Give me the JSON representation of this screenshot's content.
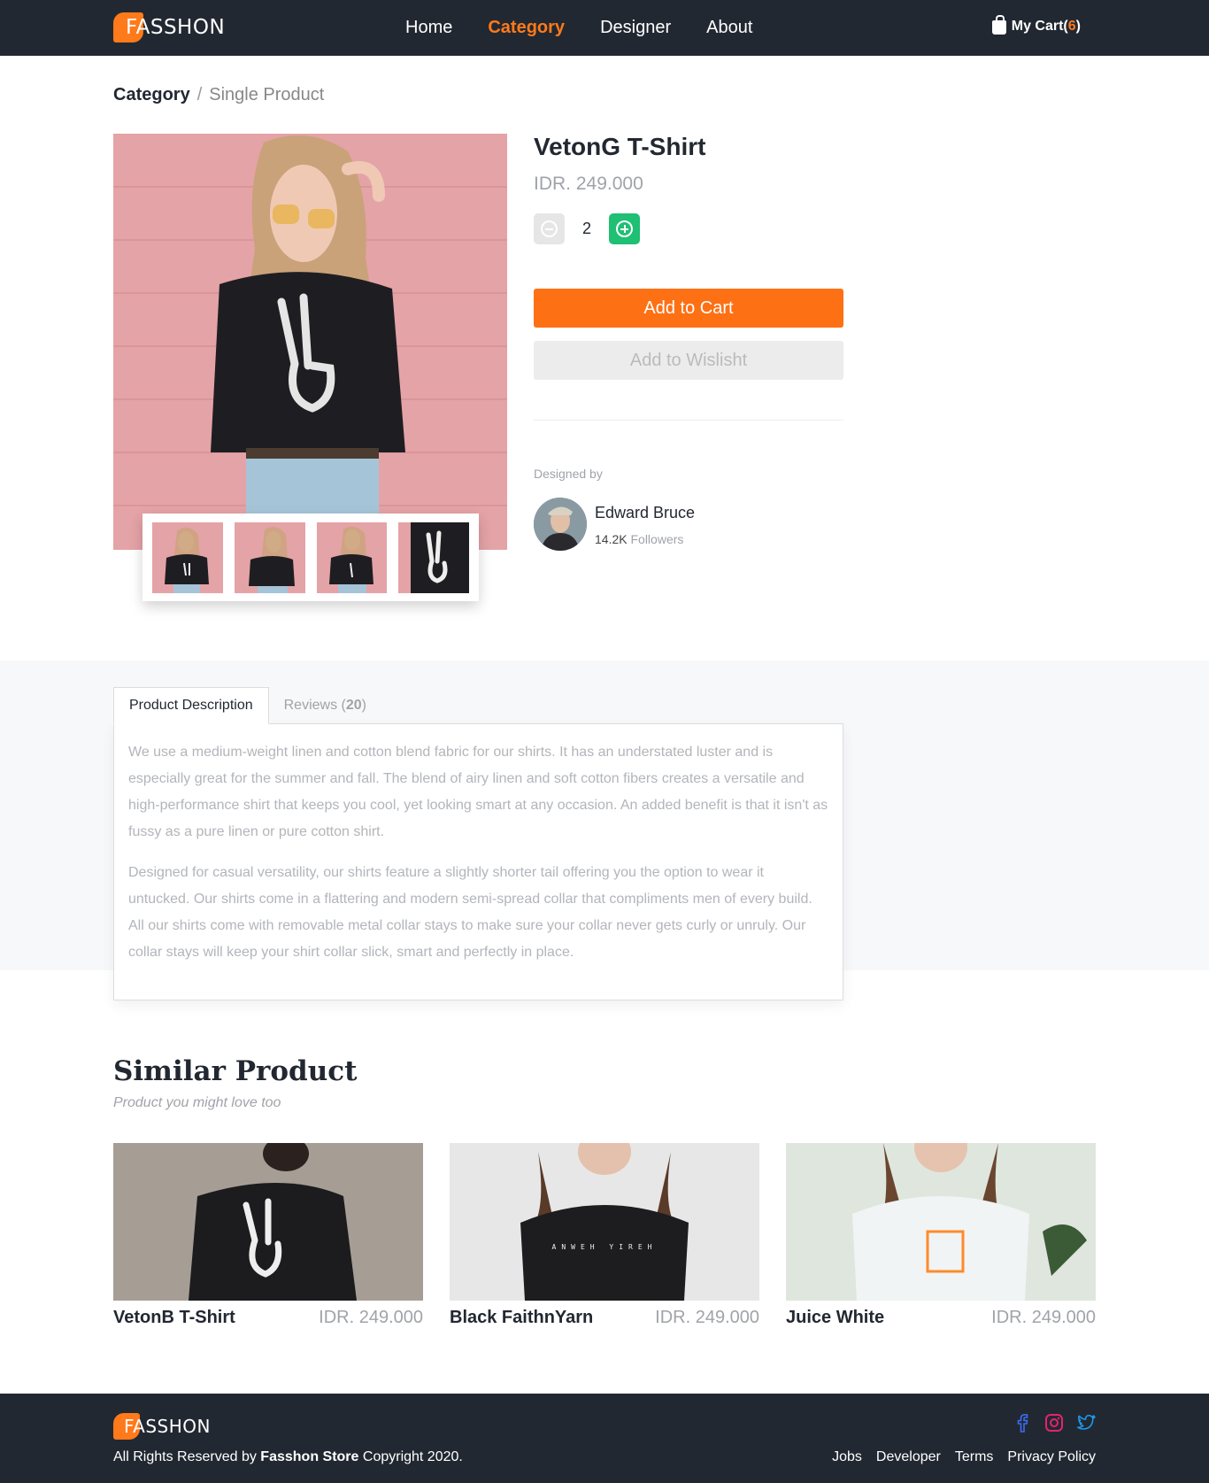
{
  "nav": {
    "brand": "FASSHON",
    "links": [
      "Home",
      "Category",
      "Designer",
      "About"
    ],
    "active": "Category",
    "cart_label": "My Cart(",
    "cart_count": "6",
    "cart_close": ")"
  },
  "breadcrumb": {
    "current": "Category",
    "separator": "/",
    "page": "Single Product"
  },
  "product": {
    "title": "VetonG T-Shirt",
    "price": "IDR. 249.000",
    "quantity": "2",
    "add_to_cart": "Add to Cart",
    "add_to_wishlist": "Add to Wislisht",
    "designed_by_label": "Designed by",
    "designer_name": "Edward Bruce",
    "designer_followers": "14.2K",
    "followers_label": "Followers"
  },
  "tabs": {
    "description_label": "Product Description",
    "reviews_label": "Reviews (",
    "reviews_count": "20",
    "reviews_close": ")"
  },
  "description": {
    "p1": "We use a medium-weight linen and cotton blend fabric for our shirts. It has an understated luster and is especially great for the summer and fall. The blend of airy linen and soft cotton fibers creates a versatile and high-performance shirt that keeps you cool, yet looking smart at any occasion. An added benefit is that it isn't as fussy as a pure linen or pure cotton shirt.",
    "p2": "Designed for casual versatility, our shirts feature a slightly shorter tail offering you the option to wear it untucked. Our shirts come in a flattering and modern semi-spread collar that compliments men of every build. All our shirts come with removable metal collar stays to make sure your collar never gets curly or unruly. Our collar stays will keep your shirt collar slick, smart and perfectly in place."
  },
  "similar": {
    "title": "Similar Product",
    "subtitle": "Product you might love too",
    "items": [
      {
        "name": "VetonB T-Shirt",
        "price": "IDR. 249.000"
      },
      {
        "name": "Black FaithnYarn",
        "price": "IDR. 249.000"
      },
      {
        "name": "Juice White",
        "price": "IDR. 249.000"
      }
    ]
  },
  "footer": {
    "brand": "FASSHON",
    "copy_prefix": "All Rights Reserved by ",
    "store": "Fasshon Store",
    "copy_suffix": " Copyright 2020.",
    "links": [
      "Jobs",
      "Developer",
      "Terms",
      "Privacy Policy"
    ],
    "social": [
      "facebook-icon",
      "instagram-icon",
      "twitter-icon"
    ]
  },
  "colors": {
    "accent": "#fd7014",
    "dark": "#222831",
    "green": "#1fbf74",
    "muted": "#a0a3a8"
  }
}
